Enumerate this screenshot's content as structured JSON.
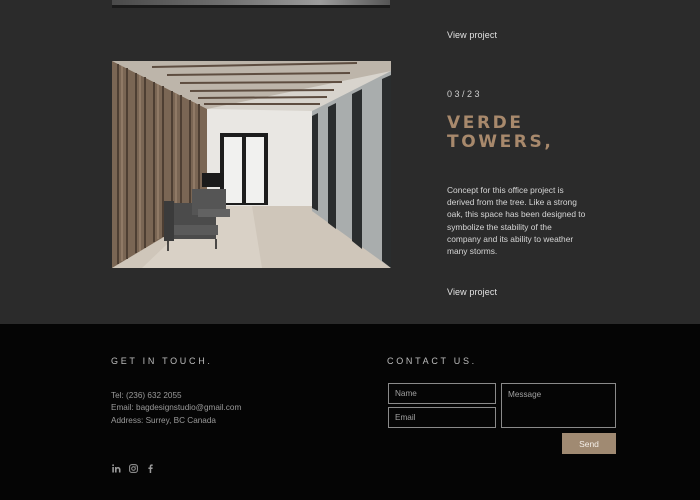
{
  "project_prev": {
    "view_label": "View project"
  },
  "project": {
    "counter": "03/23",
    "title_line1": "VERDE",
    "title_line2": "TOWERS,",
    "description": "Concept for this office project is derived from the tree. Like a strong oak, this space has been designed to symbolize the stability of the company and its ability to weather many storms.",
    "view_label": "View project"
  },
  "footer": {
    "get_in_touch": "GET IN TOUCH.",
    "tel": "Tel: (236) 632 2055",
    "email": "Email: bagdesignstudio@gmail.com",
    "address": "Address: Surrey, BC Canada",
    "social_icons": [
      "linkedin-icon",
      "instagram-icon",
      "facebook-icon"
    ],
    "contact_us": "CONTACT US.",
    "form": {
      "name_placeholder": "Name",
      "email_placeholder": "Email",
      "message_placeholder": "Message",
      "send_label": "Send"
    }
  },
  "colors": {
    "page_bg": "#2b2b2b",
    "footer_bg": "#050505",
    "accent": "#a8896c",
    "button_bg": "#a08a72"
  }
}
